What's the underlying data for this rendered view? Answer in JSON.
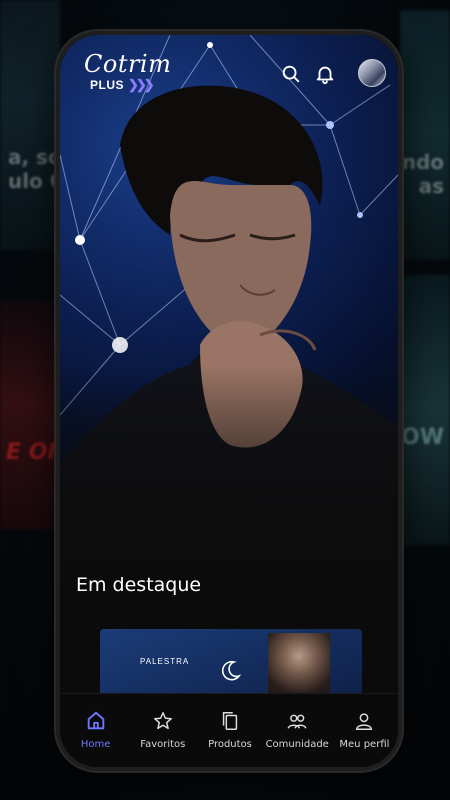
{
  "app": {
    "logo_main": "Cotrim",
    "logo_sub": "PLUS",
    "brand_color": "#6f78ff"
  },
  "background": {
    "poster_text_left": [
      "a, sou",
      "ulo Co"
    ],
    "poster_text_right": [
      "ndo",
      "as"
    ],
    "poster_text_red": "E OF ACR",
    "poster_text_cyan": "O OW"
  },
  "header": {
    "search_icon": "search-icon",
    "notifications_icon": "bell-icon",
    "avatar_icon": "profile-avatar"
  },
  "featured": {
    "title": "Em destaque",
    "card": {
      "label": "PALESTRA",
      "icon": "moon-icon"
    }
  },
  "bottom_nav": {
    "items": [
      {
        "label": "Home",
        "icon": "home-icon",
        "active": true
      },
      {
        "label": "Favoritos",
        "icon": "star-icon",
        "active": false
      },
      {
        "label": "Produtos",
        "icon": "copy-icon",
        "active": false
      },
      {
        "label": "Comunidade",
        "icon": "users-icon",
        "active": false
      },
      {
        "label": "Meu perfil",
        "icon": "user-icon",
        "active": false
      }
    ]
  }
}
